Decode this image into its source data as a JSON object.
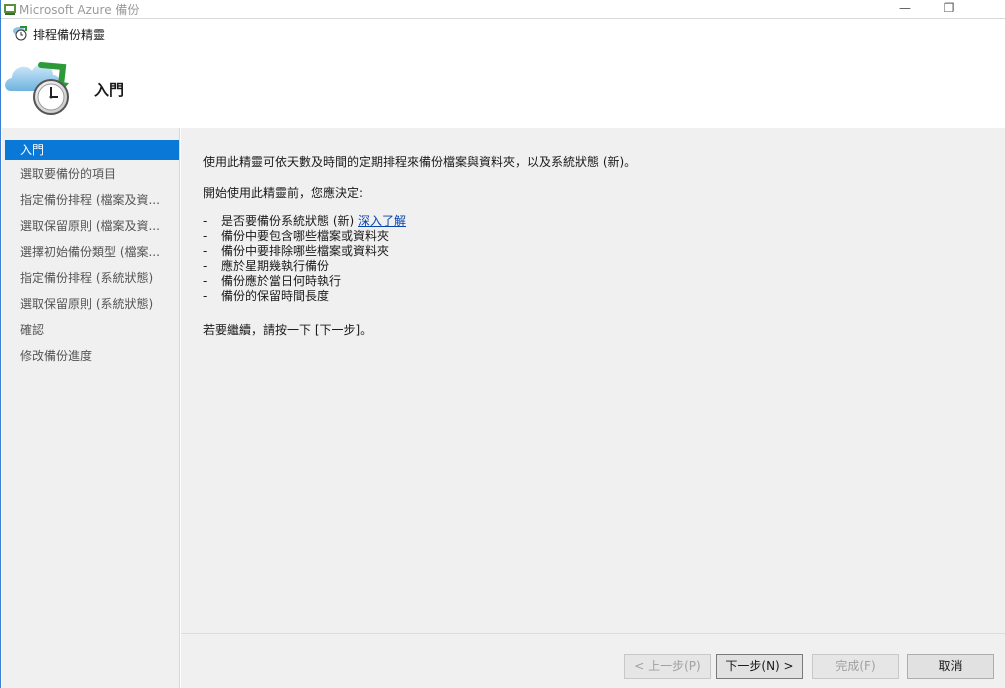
{
  "window": {
    "title": "Microsoft Azure 備份",
    "minimize_icon": "minimize-icon",
    "restore_icon": "restore-icon",
    "minimize_glyph": "—",
    "restore_glyph": "❐"
  },
  "dialog": {
    "title": "排程備份精靈",
    "header_title": "入門"
  },
  "nav": {
    "items": [
      {
        "label": "入門",
        "active": true
      },
      {
        "label": "選取要備份的項目"
      },
      {
        "label": "指定備份排程 (檔案及資..."
      },
      {
        "label": "選取保留原則 (檔案及資..."
      },
      {
        "label": "選擇初始備份類型 (檔案..."
      },
      {
        "label": "指定備份排程 (系統狀態)"
      },
      {
        "label": "選取保留原則 (系統狀態)"
      },
      {
        "label": "確認"
      },
      {
        "label": "修改備份進度"
      }
    ]
  },
  "content": {
    "intro": "使用此精靈可依天數及時間的定期排程來備份檔案與資料夾，以及系統狀態 (新)。",
    "before_start": "開始使用此精靈前，您應決定:",
    "bullets": [
      {
        "text": "是否要備份系統狀態 (新)",
        "link": "深入了解"
      },
      {
        "text": "備份中要包含哪些檔案或資料夾"
      },
      {
        "text": "備份中要排除哪些檔案或資料夾"
      },
      {
        "text": "應於星期幾執行備份"
      },
      {
        "text": "備份應於當日何時執行"
      },
      {
        "text": "備份的保留時間長度"
      }
    ],
    "continue_text": "若要繼續，請按一下 [下一步]。"
  },
  "buttons": {
    "back": "< 上一步(P)",
    "next": "下一步(N) >",
    "finish": "完成(F)",
    "cancel": "取消"
  }
}
